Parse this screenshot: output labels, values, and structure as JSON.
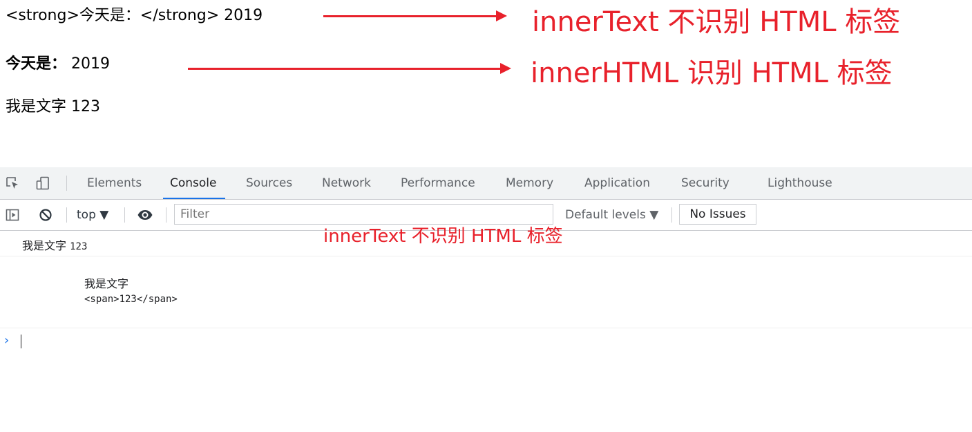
{
  "page": {
    "line1": "<strong>今天是：</strong> 2019",
    "line2_bold": "今天是：",
    "line2_rest": " 2019",
    "line3": "我是文字 123"
  },
  "annotations": {
    "first": "innerText 不识别 HTML 标签",
    "second": "innerHTML 识别 HTML 标签",
    "caption": "innerText 不识别 HTML 标签",
    "color": "#e8212b"
  },
  "devtools": {
    "tabs": [
      "Elements",
      "Console",
      "Sources",
      "Network",
      "Performance",
      "Memory",
      "Application",
      "Security",
      "Lighthouse"
    ],
    "active_tab": "Console",
    "toolbar": {
      "context": "top ▼",
      "filter_placeholder": "Filter",
      "levels": "Default levels ▼",
      "issues": "No Issues"
    },
    "console": {
      "msg1_text": "我是文字",
      "msg1_num": "123",
      "msg2_line1": "我是文字",
      "msg2_line2": "<span>123</span>",
      "prompt": "›"
    },
    "accent": "#1a73e8"
  }
}
